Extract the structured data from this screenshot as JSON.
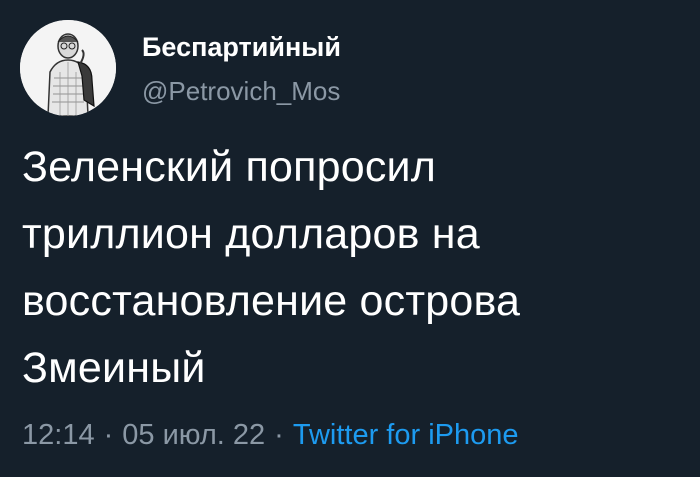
{
  "tweet": {
    "display_name": "Беспартийный",
    "handle": "@Petrovich_Mos",
    "text_lines": [
      "Зеленский попросил",
      "триллион долларов на",
      "восстановление острова",
      "Змеиный"
    ],
    "time": "12:14",
    "date": "05 июл. 22",
    "separator": "·",
    "source": "Twitter for iPhone"
  },
  "colors": {
    "background": "#15202b",
    "text": "#ffffff",
    "secondary_text": "#8b98a5",
    "link": "#1d9bf0"
  },
  "icons": {
    "avatar": "avatar-man-sketch"
  }
}
